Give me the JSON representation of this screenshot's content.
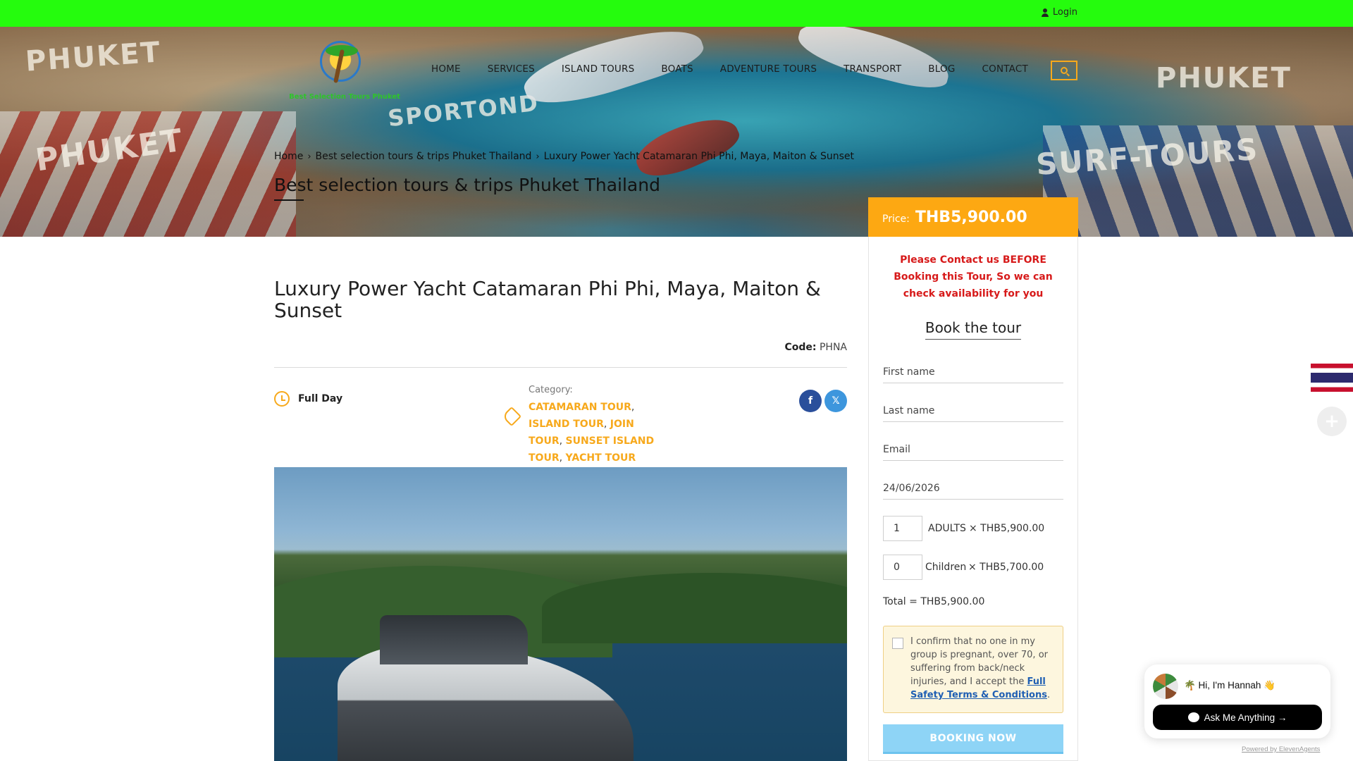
{
  "topbar": {
    "login_label": "Login",
    "bg_color": "#25fc0d"
  },
  "logo": {
    "name": "Best Selection Tours Phuket"
  },
  "nav": {
    "items": [
      "HOME",
      "SERVICES",
      "ISLAND TOURS",
      "BOATS",
      "ADVENTURE TOURS",
      "TRANSPORT",
      "BLOG",
      "CONTACT"
    ],
    "search_icon": "search-icon"
  },
  "breadcrumb": {
    "items": [
      "Home",
      "Best selection tours & trips Phuket Thailand",
      "Luxury Power Yacht Catamaran Phi Phi, Maya, Maiton & Sunset"
    ]
  },
  "hero": {
    "title": "Best selection tours & trips Phuket Thailand"
  },
  "tour": {
    "title": "Luxury Power Yacht Catamaran Phi Phi, Maya, Maiton & Sunset",
    "code_label": "Code:",
    "code_value": "PHNA",
    "duration": "Full Day",
    "category_label": "Category:",
    "categories": [
      "CATAMARAN TOUR",
      "ISLAND TOUR",
      "JOIN TOUR",
      "SUNSET ISLAND TOUR",
      "YACHT TOUR"
    ],
    "share": {
      "facebook": "f",
      "twitter": "𝕏"
    }
  },
  "booking": {
    "price_label": "Price:",
    "price_value": "THB5,900.00",
    "notice": "Please Contact us BEFORE Booking this Tour, So we can check availability for you",
    "title": "Book the tour",
    "first_name_placeholder": "First name",
    "last_name_placeholder": "Last name",
    "email_placeholder": "Email",
    "date_value": "24/06/2026",
    "adults_qty": "1",
    "adults_label": "ADULTS",
    "adults_price": "× THB5,900.00",
    "children_qty": "0",
    "children_label": "Children",
    "children_price": "× THB5,700.00",
    "total": "Total = THB5,900.00",
    "terms_text": "I confirm that no one in my group is pregnant, over 70, or suffering from back/neck injuries, and I accept the ",
    "terms_link": "Full Safety Terms & Conditions",
    "terms_end": ".",
    "book_button": "BOOKING NOW",
    "accent_color": "#fda812",
    "notice_color": "#d71a1a"
  },
  "chat": {
    "greeting": "🌴 Hi, I'm Hannah 👋",
    "ask_button": "Ask Me Anything →",
    "powered_prefix": "Powered by ",
    "powered_link": "ElevenAgents"
  }
}
